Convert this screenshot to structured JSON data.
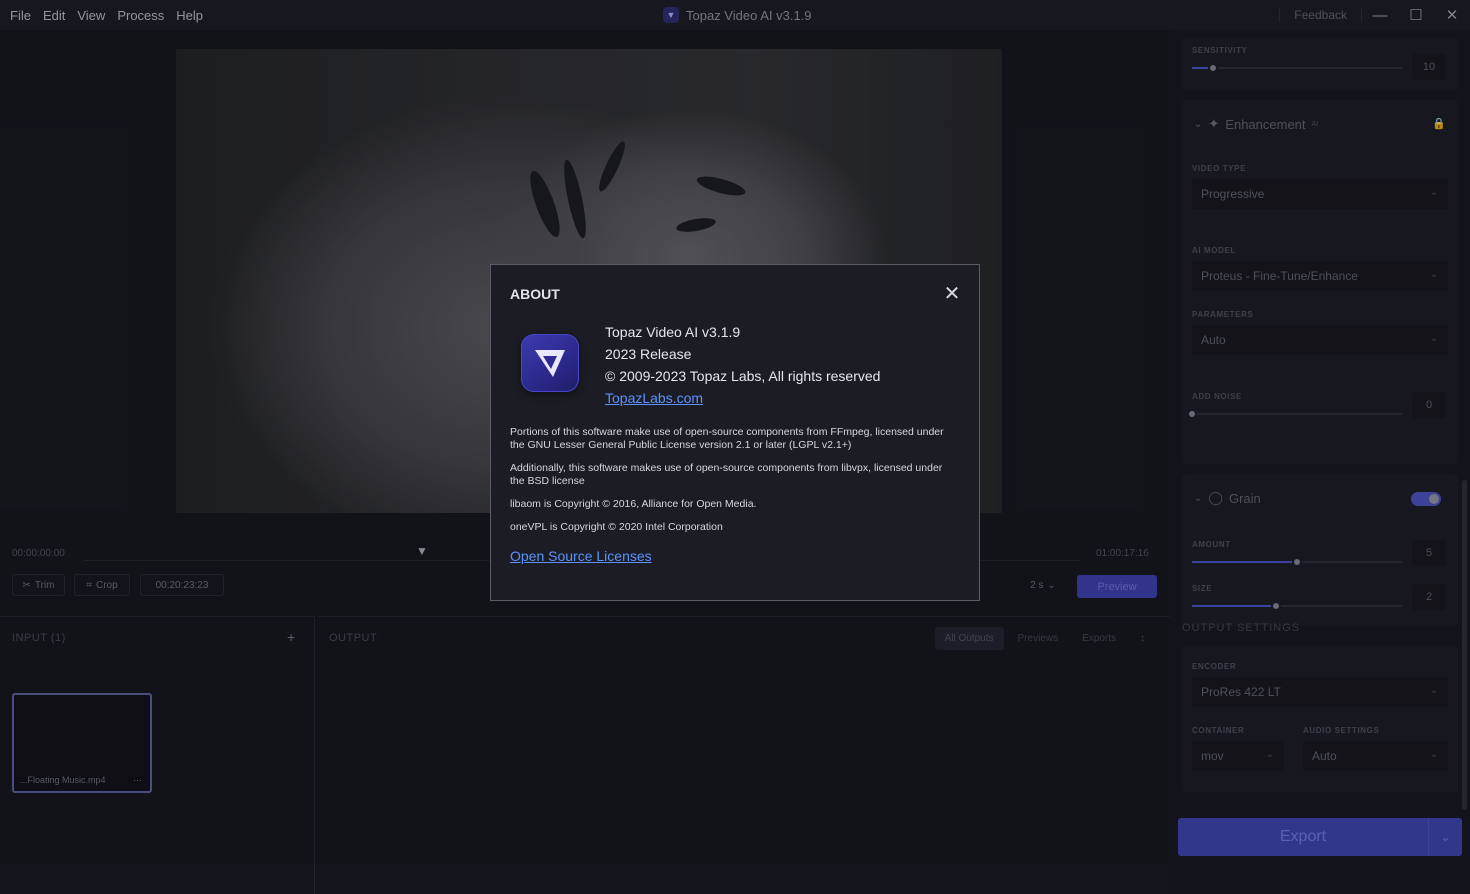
{
  "menu": [
    "File",
    "Edit",
    "View",
    "Process",
    "Help"
  ],
  "app_title": "Topaz Video AI  v3.1.9",
  "window": {
    "feedback": "Feedback",
    "minimize": "—",
    "maximize": "☐",
    "close": "✕"
  },
  "timeline": {
    "start": "00:00:00:00",
    "end": "01:00:17:16"
  },
  "toolbar": {
    "trim": "Trim",
    "crop": "Crop",
    "timecode": "00:20:23:23",
    "duration": "2 s",
    "preview": "Preview"
  },
  "input_panel": {
    "title": "INPUT (1)",
    "add": "+",
    "clip_name": "...Floating Music.mp4",
    "clip_menu": "···"
  },
  "output_panel": {
    "title": "OUTPUT",
    "tabs": [
      "All Outputs",
      "Previews",
      "Exports"
    ],
    "sort": "↕"
  },
  "settings": {
    "sensitivity": {
      "label": "SENSITIVITY",
      "value": "10",
      "level": 0.1
    },
    "enhancement": {
      "title": "Enhancement",
      "badge": "AI",
      "video_type_label": "VIDEO TYPE",
      "video_type": "Progressive",
      "ai_model_label": "AI MODEL",
      "ai_model": "Proteus - Fine-Tune/Enhance",
      "parameters_label": "PARAMETERS",
      "parameters": "Auto",
      "add_noise_label": "ADD NOISE",
      "add_noise": "0",
      "add_noise_level": 0
    },
    "grain": {
      "title": "Grain",
      "enabled": true,
      "amount_label": "AMOUNT",
      "amount": "5",
      "amount_level": 0.5,
      "size_label": "SIZE",
      "size": "2",
      "size_level": 0.4
    },
    "output": {
      "section_label": "OUTPUT SETTINGS",
      "encoder_label": "ENCODER",
      "encoder": "ProRes 422 LT",
      "container_label": "CONTAINER",
      "container": "mov",
      "audio_label": "AUDIO SETTINGS",
      "audio": "Auto"
    },
    "export": "Export"
  },
  "about": {
    "title": "ABOUT",
    "product": "Topaz Video AI  v3.1.9",
    "release": "2023 Release",
    "copyright": "© 2009-2023 Topaz Labs, All rights reserved",
    "website": "TopazLabs.com",
    "legal_1": "Portions of this software make use of open-source components from FFmpeg, licensed under the GNU Lesser General Public License version 2.1 or later (LGPL v2.1+)",
    "legal_2": "Additionally, this software makes use of open-source components from libvpx, licensed under the BSD license",
    "legal_3": "libaom is Copyright © 2016, Alliance for Open Media.",
    "legal_4": "oneVPL is Copyright © 2020 Intel Corporation",
    "oss_link": "Open Source Licenses"
  }
}
